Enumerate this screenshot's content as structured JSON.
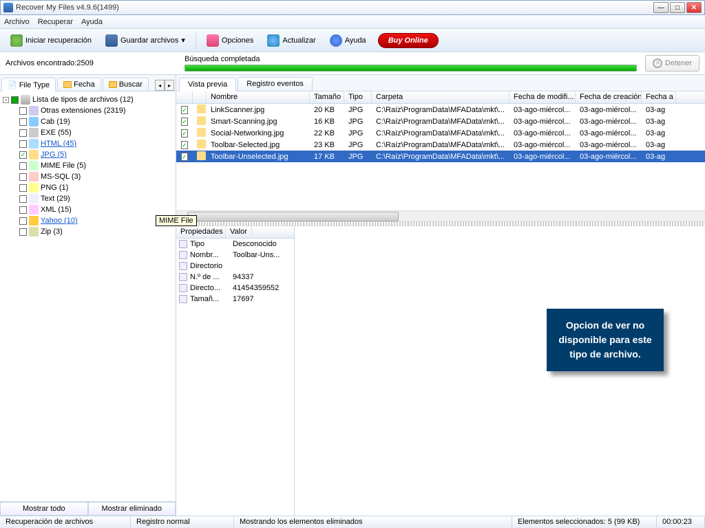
{
  "window": {
    "title": "Recover My Files v4.9.6(1499)"
  },
  "menu": {
    "archivo": "Archivo",
    "recuperar": "Recuperar",
    "ayuda": "Ayuda"
  },
  "toolbar": {
    "iniciar": "Iniciar recuperación",
    "guardar": "Guardar archivos",
    "opciones": "Opciones",
    "actualizar": "Actualizar",
    "ayuda": "Ayuda",
    "buy": "Buy Online"
  },
  "status": {
    "found": "Archivos encontrado:2509",
    "search": "Búsqueda completada",
    "stop": "Detener"
  },
  "leftTabs": {
    "filetype": "File Type",
    "fecha": "Fecha",
    "buscar": "Buscar"
  },
  "tree": {
    "root": "Lista de tipos de archivos (12)",
    "items": [
      {
        "label": "Otras extensiones (2319)",
        "ico": "fi-oth",
        "chk": false
      },
      {
        "label": "Cab (19)",
        "ico": "fi-cab",
        "chk": false
      },
      {
        "label": "EXE (55)",
        "ico": "fi-exe",
        "chk": false
      },
      {
        "label": "HTML (45)",
        "ico": "fi-htm",
        "chk": false,
        "link": true
      },
      {
        "label": "JPG (5)",
        "ico": "fi-jpg",
        "chk": true,
        "link": true
      },
      {
        "label": "MIME File (5)",
        "ico": "fi-mime",
        "chk": false
      },
      {
        "label": "MS-SQL (3)",
        "ico": "fi-sql",
        "chk": false
      },
      {
        "label": "PNG (1)",
        "ico": "fi-png",
        "chk": false
      },
      {
        "label": "Text (29)",
        "ico": "fi-txt",
        "chk": false
      },
      {
        "label": "XML (15)",
        "ico": "fi-xml",
        "chk": false
      },
      {
        "label": "Yahoo (10)",
        "ico": "fi-yah",
        "chk": false,
        "link": true
      },
      {
        "label": "Zip (3)",
        "ico": "fi-zip",
        "chk": false
      }
    ]
  },
  "tooltip": "MIME File",
  "leftBottom": {
    "todo": "Mostrar todo",
    "elim": "Mostrar eliminado"
  },
  "rightTabs": {
    "vista": "Vista previa",
    "registro": "Registro eventos"
  },
  "cols": {
    "nombre": "Nombre",
    "tamano": "Tamaño",
    "tipo": "Tipo",
    "carpeta": "Carpeta",
    "mod": "Fecha de modifi...",
    "crea": "Fecha de creación",
    "acc": "Fecha a"
  },
  "rows": [
    {
      "n": "LinkScanner.jpg",
      "s": "20 KB",
      "t": "JPG",
      "c": "C:\\Raíz\\ProgramData\\MFAData\\mkt\\...",
      "m": "03-ago-miércol...",
      "r": "03-ago-miércol...",
      "a": "03-ag",
      "sel": false
    },
    {
      "n": "Smart-Scanning.jpg",
      "s": "16 KB",
      "t": "JPG",
      "c": "C:\\Raíz\\ProgramData\\MFAData\\mkt\\...",
      "m": "03-ago-miércol...",
      "r": "03-ago-miércol...",
      "a": "03-ag",
      "sel": false
    },
    {
      "n": "Social-Networking.jpg",
      "s": "22 KB",
      "t": "JPG",
      "c": "C:\\Raíz\\ProgramData\\MFAData\\mkt\\...",
      "m": "03-ago-miércol...",
      "r": "03-ago-miércol...",
      "a": "03-ag",
      "sel": false
    },
    {
      "n": "Toolbar-Selected.jpg",
      "s": "23 KB",
      "t": "JPG",
      "c": "C:\\Raíz\\ProgramData\\MFAData\\mkt\\...",
      "m": "03-ago-miércol...",
      "r": "03-ago-miércol...",
      "a": "03-ag",
      "sel": false
    },
    {
      "n": "Toolbar-Unselected.jpg",
      "s": "17 KB",
      "t": "JPG",
      "c": "C:\\Raíz\\ProgramData\\MFAData\\mkt\\...",
      "m": "03-ago-miércol...",
      "r": "03-ago-miércol...",
      "a": "03-ag",
      "sel": true
    }
  ],
  "props": {
    "h1": "Propiedades",
    "h2": "Valor",
    "items": [
      {
        "k": "Tipo",
        "v": "Desconocido"
      },
      {
        "k": "Nombr...",
        "v": "Toolbar-Uns..."
      },
      {
        "k": "Directorio",
        "v": ""
      },
      {
        "k": "N.º de ...",
        "v": "94337"
      },
      {
        "k": "Directo...",
        "v": "41454359552"
      },
      {
        "k": "Tamañ...",
        "v": "17697"
      }
    ]
  },
  "noprev": "Opcion de ver no disponible para este tipo de archivo.",
  "statusbar": {
    "s1": "Recuperación de archivos",
    "s2": "Registro normal",
    "s3": "Mostrando los elementos eliminados",
    "s4": "Elementos seleccionados: 5 (99 KB)",
    "s5": "00:00:23"
  }
}
